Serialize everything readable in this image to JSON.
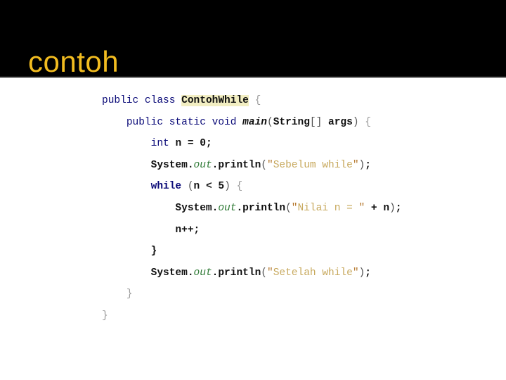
{
  "slide": {
    "title": "contoh",
    "title_color": "#f2bc20",
    "band_color": "#000000",
    "background_color": "#ffffff",
    "rule_color": "#808080"
  },
  "code": {
    "language": "java",
    "highlight_colors": {
      "keyword": "#0a0a78",
      "class_name": "#101010",
      "class_highlight_bg": "#f2eec2",
      "method": "#101010",
      "field": "#2f7a36",
      "string": "#c7a85c",
      "string_quote": "#b4762a",
      "punctuation": "#555555",
      "dim_brace": "#9a9a9a"
    },
    "lines": [
      {
        "indent": 0,
        "tokens": [
          {
            "t": "public",
            "k": "kw-light"
          },
          {
            "t": " ",
            "k": "punc"
          },
          {
            "t": "class",
            "k": "kw-light"
          },
          {
            "t": " ",
            "k": "punc"
          },
          {
            "t": "ContohWhile",
            "k": "cls"
          },
          {
            "t": " ",
            "k": "punc"
          },
          {
            "t": "{",
            "k": "brace-dim"
          }
        ]
      },
      {
        "indent": 1,
        "tokens": [
          {
            "t": "public",
            "k": "kw-light"
          },
          {
            "t": " ",
            "k": "punc"
          },
          {
            "t": "static",
            "k": "kw-light"
          },
          {
            "t": " ",
            "k": "punc"
          },
          {
            "t": "void",
            "k": "kw-light"
          },
          {
            "t": " ",
            "k": "punc"
          },
          {
            "t": "main",
            "k": "mth"
          },
          {
            "t": "(",
            "k": "punc"
          },
          {
            "t": "String",
            "k": "plain"
          },
          {
            "t": "[] ",
            "k": "punc"
          },
          {
            "t": "args",
            "k": "plain"
          },
          {
            "t": ")",
            "k": "punc"
          },
          {
            "t": " ",
            "k": "punc"
          },
          {
            "t": "{",
            "k": "brace-dim"
          }
        ]
      },
      {
        "indent": 2,
        "tokens": [
          {
            "t": "int",
            "k": "type"
          },
          {
            "t": " ",
            "k": "punc"
          },
          {
            "t": "n",
            "k": "plain"
          },
          {
            "t": " = ",
            "k": "plain"
          },
          {
            "t": "0",
            "k": "plain"
          },
          {
            "t": ";",
            "k": "plain"
          }
        ]
      },
      {
        "indent": 2,
        "tokens": [
          {
            "t": "System",
            "k": "plain"
          },
          {
            "t": ".",
            "k": "plain"
          },
          {
            "t": "out",
            "k": "fld"
          },
          {
            "t": ".",
            "k": "plain"
          },
          {
            "t": "println",
            "k": "plain"
          },
          {
            "t": "(",
            "k": "punc"
          },
          {
            "t": "\"",
            "k": "strq"
          },
          {
            "t": "Sebelum while",
            "k": "str"
          },
          {
            "t": "\"",
            "k": "strq"
          },
          {
            "t": ")",
            "k": "punc"
          },
          {
            "t": ";",
            "k": "plain"
          }
        ]
      },
      {
        "indent": 2,
        "tokens": [
          {
            "t": "while",
            "k": "kw"
          },
          {
            "t": " ",
            "k": "punc"
          },
          {
            "t": "(",
            "k": "punc"
          },
          {
            "t": "n",
            "k": "plain"
          },
          {
            "t": " < ",
            "k": "plain"
          },
          {
            "t": "5",
            "k": "plain"
          },
          {
            "t": ")",
            "k": "punc"
          },
          {
            "t": " ",
            "k": "punc"
          },
          {
            "t": "{",
            "k": "brace-dim"
          }
        ]
      },
      {
        "indent": 3,
        "tokens": [
          {
            "t": "System",
            "k": "plain"
          },
          {
            "t": ".",
            "k": "plain"
          },
          {
            "t": "out",
            "k": "fld"
          },
          {
            "t": ".",
            "k": "plain"
          },
          {
            "t": "println",
            "k": "plain"
          },
          {
            "t": "(",
            "k": "punc"
          },
          {
            "t": "\"",
            "k": "strq"
          },
          {
            "t": "Nilai n = ",
            "k": "str"
          },
          {
            "t": "\"",
            "k": "strq"
          },
          {
            "t": " + ",
            "k": "plain"
          },
          {
            "t": "n",
            "k": "plain"
          },
          {
            "t": ")",
            "k": "punc"
          },
          {
            "t": ";",
            "k": "plain"
          }
        ]
      },
      {
        "indent": 3,
        "tokens": [
          {
            "t": "n++",
            "k": "plain"
          },
          {
            "t": ";",
            "k": "plain"
          }
        ]
      },
      {
        "indent": 2,
        "tokens": [
          {
            "t": "}",
            "k": "plain"
          }
        ]
      },
      {
        "indent": 2,
        "tokens": [
          {
            "t": "System",
            "k": "plain"
          },
          {
            "t": ".",
            "k": "plain"
          },
          {
            "t": "out",
            "k": "fld"
          },
          {
            "t": ".",
            "k": "plain"
          },
          {
            "t": "println",
            "k": "plain"
          },
          {
            "t": "(",
            "k": "punc"
          },
          {
            "t": "\"",
            "k": "strq"
          },
          {
            "t": "Setelah while",
            "k": "str"
          },
          {
            "t": "\"",
            "k": "strq"
          },
          {
            "t": ")",
            "k": "punc"
          },
          {
            "t": ";",
            "k": "plain"
          }
        ]
      },
      {
        "indent": 1,
        "tokens": [
          {
            "t": "}",
            "k": "brace-dim"
          }
        ]
      },
      {
        "indent": 0,
        "tokens": [
          {
            "t": "}",
            "k": "brace-dim"
          }
        ]
      }
    ]
  }
}
